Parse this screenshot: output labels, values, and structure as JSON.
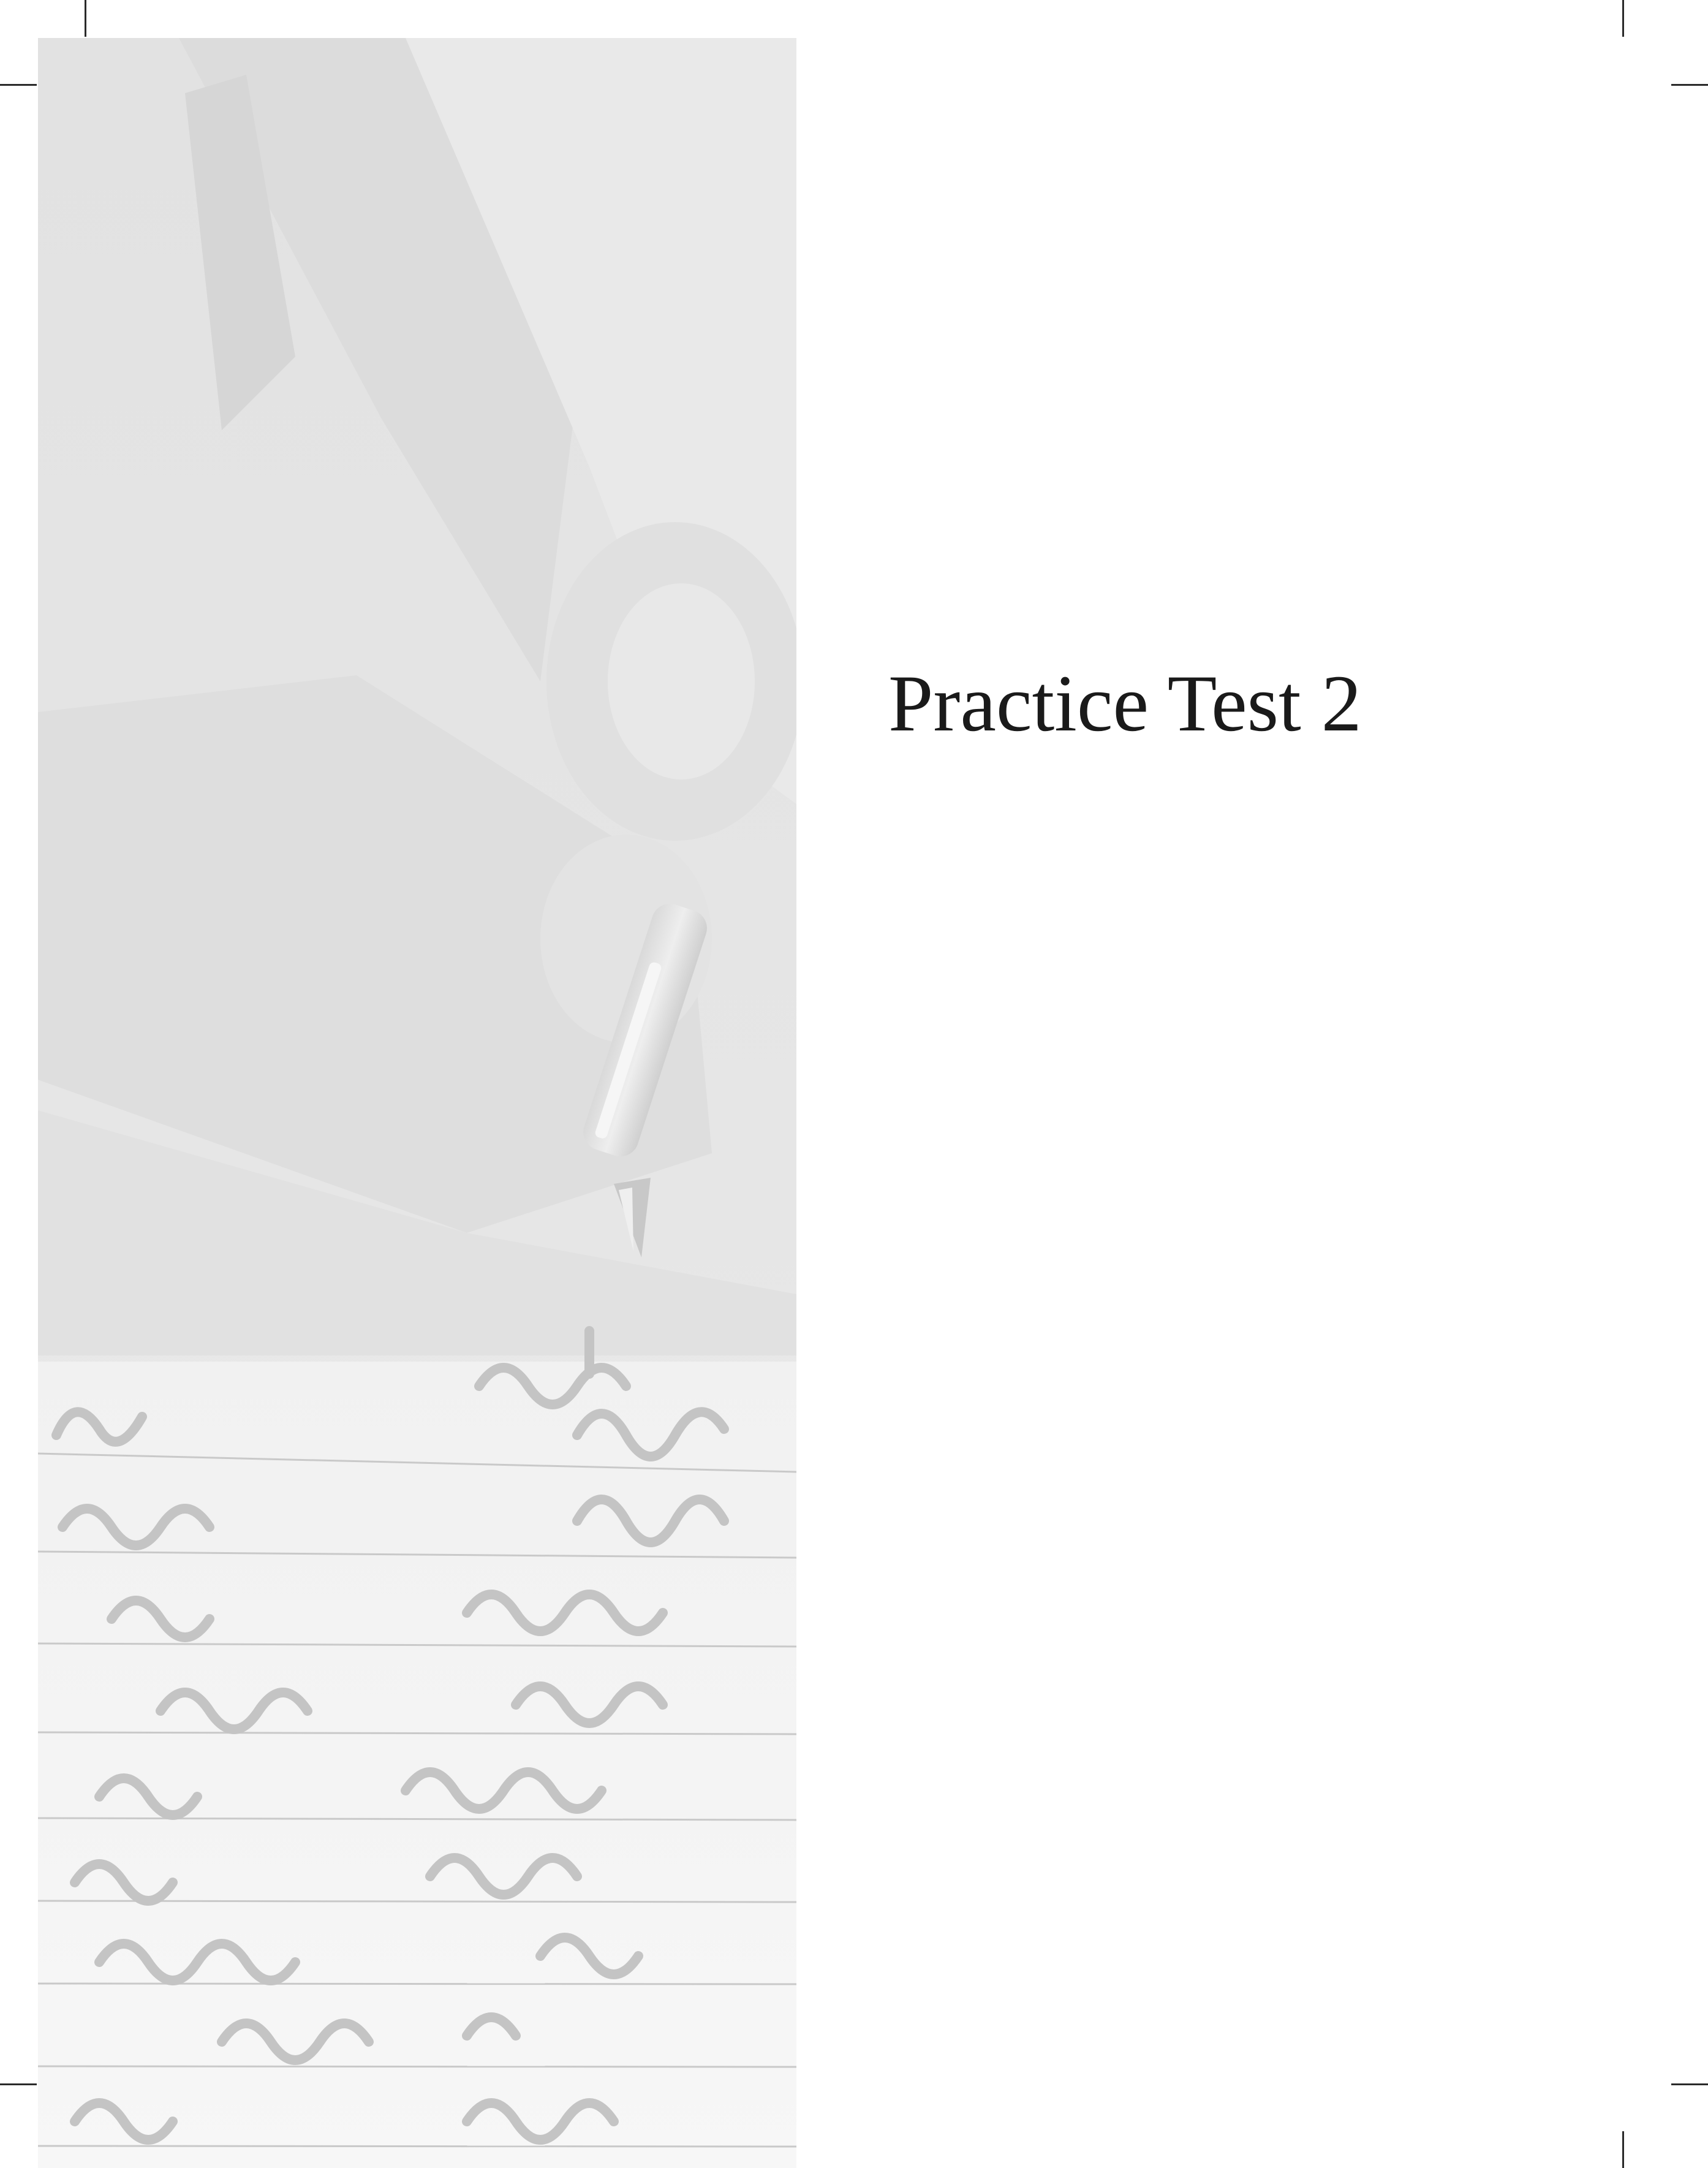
{
  "page": {
    "title": "Practice Test 2"
  },
  "background_image": {
    "icon": "hand-writing-photo",
    "style": "grayscale faded photo"
  },
  "colors": {
    "text": "#1a1a1a",
    "panel": "#e4e4e4",
    "crop_marks": "#2a2a2a"
  }
}
